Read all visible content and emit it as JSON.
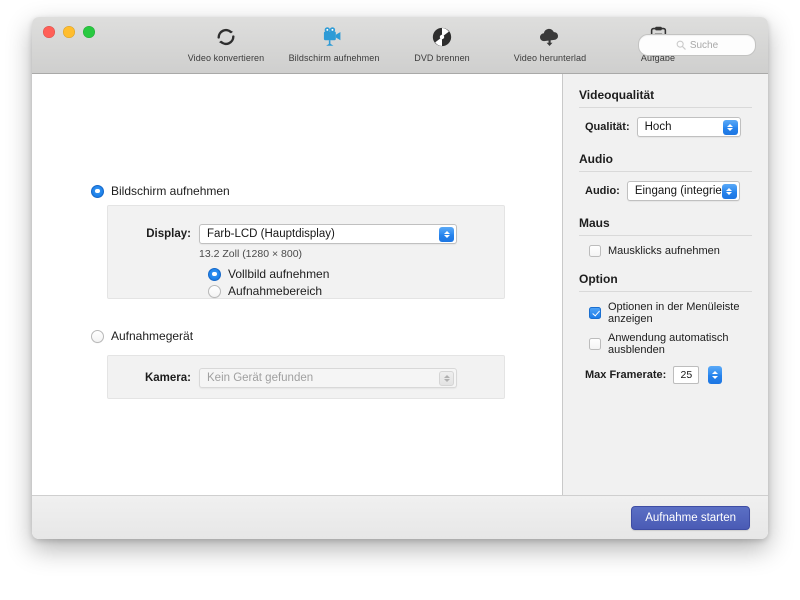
{
  "window": {
    "traffic_lights": [
      {
        "name": "close",
        "color": "#ff5f57"
      },
      {
        "name": "minimize",
        "color": "#ffbd2e"
      },
      {
        "name": "zoom",
        "color": "#28c940"
      }
    ]
  },
  "toolbar": {
    "items": [
      {
        "label": "Video konvertieren",
        "icon": "convert-icon",
        "active": false
      },
      {
        "label": "Bildschirm aufnehmen",
        "icon": "screen-record-icon",
        "active": true
      },
      {
        "label": "DVD brennen",
        "icon": "dvd-burn-icon",
        "active": false
      },
      {
        "label": "Video herunterlad",
        "icon": "cloud-download-icon",
        "active": false
      },
      {
        "label": "Aufgabe",
        "icon": "task-clipboard-icon",
        "active": false
      }
    ],
    "search": {
      "placeholder": "Suche",
      "value": "",
      "icon": "search-icon"
    }
  },
  "main": {
    "screen_option": {
      "label": "Bildschirm aufnehmen",
      "selected": true
    },
    "display": {
      "field_label": "Display:",
      "value": "Farb-LCD (Hauptdisplay)",
      "note": "13.2 Zoll (1280 × 800)"
    },
    "capture_modes": [
      {
        "label": "Vollbild aufnehmen",
        "selected": true
      },
      {
        "label": "Aufnahmebereich",
        "selected": false
      }
    ],
    "device_option": {
      "label": "Aufnahmegerät",
      "selected": false
    },
    "camera": {
      "field_label": "Kamera:",
      "value": "Kein Gerät gefunden",
      "disabled": true
    }
  },
  "sidebar": {
    "sections": [
      {
        "title": "Videoqualität",
        "field_label": "Qualität:",
        "value": "Hoch"
      },
      {
        "title": "Audio",
        "field_label": "Audio:",
        "value": "Eingang (integriert)"
      },
      {
        "title": "Maus",
        "checkbox_label": "Mausklicks aufnehmen",
        "checked": false
      },
      {
        "title": "Option",
        "checkbox1_label": "Optionen in der Menüleiste anzeigen",
        "checked1": true,
        "checkbox2_label": "Anwendung automatisch ausblenden",
        "checked2": false,
        "framerate_label": "Max Framerate:",
        "framerate_value": "25"
      }
    ]
  },
  "footer": {
    "start_button": "Aufnahme starten"
  },
  "colors": {
    "accent_blue": "#2683ec",
    "primary_button": "#4a5bb5",
    "toolbar_active": "#2e9bd6"
  }
}
